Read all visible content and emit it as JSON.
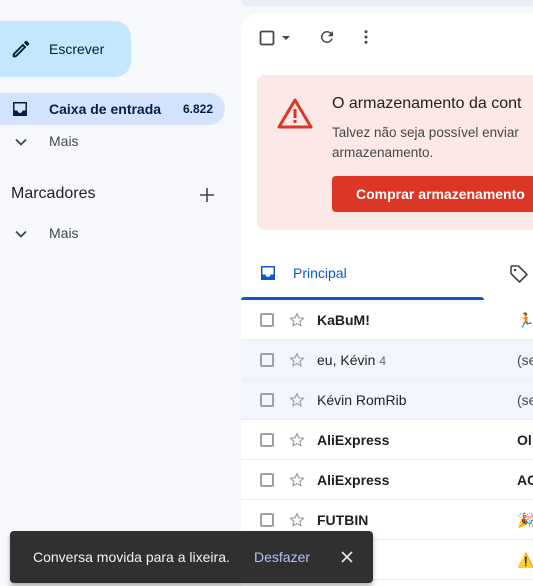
{
  "sidebar": {
    "compose_label": "Escrever",
    "inbox_label": "Caixa de entrada",
    "inbox_count": "6.822",
    "more_label": "Mais",
    "labels_heading": "Marcadores",
    "labels_more_label": "Mais"
  },
  "banner": {
    "title": "O armazenamento da cont",
    "message": "Talvez não seja possível enviar armazenamento.",
    "buy_button": "Comprar armazenamento"
  },
  "tabs": {
    "principal_label": "Principal"
  },
  "emails": [
    {
      "sender": "KaBuM!",
      "count": "",
      "preview": "🏃",
      "read": false
    },
    {
      "sender": "eu, Kévin",
      "count": "4",
      "preview": "(se",
      "read": true
    },
    {
      "sender": "Kévin RomRib",
      "count": "",
      "preview": "(se",
      "read": true
    },
    {
      "sender": "AliExpress",
      "count": "",
      "preview": "Ol",
      "read": false
    },
    {
      "sender": "AliExpress",
      "count": "",
      "preview": "AC",
      "read": false
    },
    {
      "sender": "FUTBIN",
      "count": "",
      "preview": "🎉",
      "read": false
    },
    {
      "sender": "",
      "count": "",
      "preview": "⚠️",
      "read": false
    }
  ],
  "snackbar": {
    "message": "Conversa movida para a lixeira.",
    "undo_label": "Desfazer"
  },
  "colors": {
    "accent": "#0b57d0",
    "compose_bg": "#c2e7ff",
    "inbox_active_bg": "#d3e3fd",
    "banner_bg": "#fce8e6",
    "buy_button_bg": "#dc3626",
    "warning_red": "#dc3626"
  }
}
